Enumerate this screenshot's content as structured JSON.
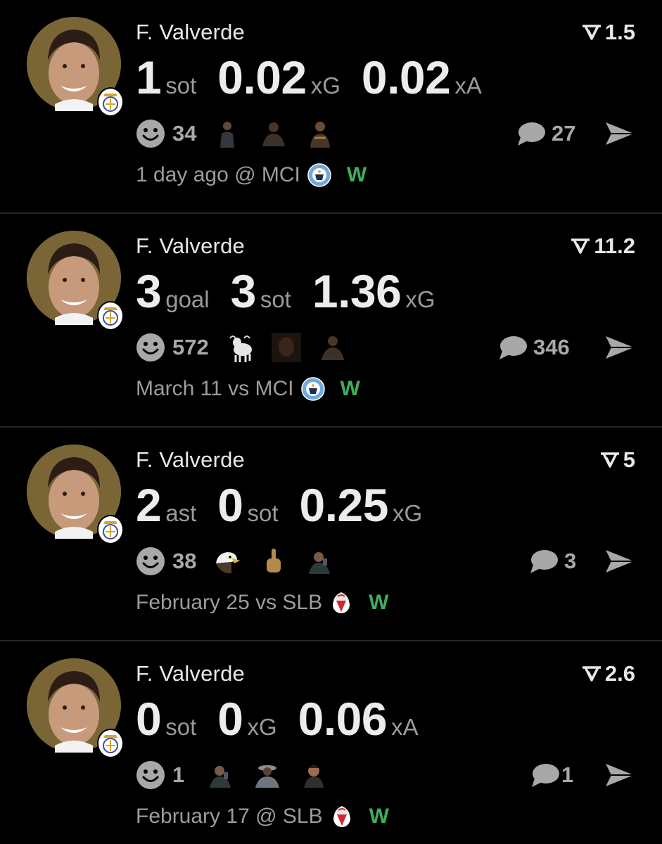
{
  "colors": {
    "background": "#000000",
    "primary_text": "#e8e8e8",
    "secondary_text": "#9c9c9c",
    "win": "#3fae5a",
    "avatar_ring": "#7a6536"
  },
  "posts": [
    {
      "player": "F. Valverde",
      "rating": "1.5",
      "stats": [
        {
          "value": "1",
          "unit": "sot"
        },
        {
          "value": "0.02",
          "unit": "xG"
        },
        {
          "value": "0.02",
          "unit": "xA"
        }
      ],
      "reaction_count": "34",
      "reaction_thumbs": [
        "person-thumb",
        "person-thumb",
        "person-thumb"
      ],
      "comment_count": "27",
      "match": "1 day ago @ MCI",
      "team_logo": "man-city-logo-icon",
      "result": "W"
    },
    {
      "player": "F. Valverde",
      "rating": "11.2",
      "stats": [
        {
          "value": "3",
          "unit": "goal"
        },
        {
          "value": "3",
          "unit": "sot"
        },
        {
          "value": "1.36",
          "unit": "xG"
        }
      ],
      "reaction_count": "572",
      "reaction_thumbs": [
        "goat-thumb",
        "person-thumb",
        "person-thumb"
      ],
      "comment_count": "346",
      "match": "March 11 vs MCI",
      "team_logo": "man-city-logo-icon",
      "result": "W"
    },
    {
      "player": "F. Valverde",
      "rating": "5",
      "stats": [
        {
          "value": "2",
          "unit": "ast"
        },
        {
          "value": "0",
          "unit": "sot"
        },
        {
          "value": "0.25",
          "unit": "xG"
        }
      ],
      "reaction_count": "38",
      "reaction_thumbs": [
        "eagle-thumb",
        "hand-thumb",
        "person-thumb"
      ],
      "comment_count": "3",
      "match": "February 25 vs SLB",
      "team_logo": "benfica-logo-icon",
      "result": "W"
    },
    {
      "player": "F. Valverde",
      "rating": "2.6",
      "stats": [
        {
          "value": "0",
          "unit": "sot"
        },
        {
          "value": "0",
          "unit": "xG"
        },
        {
          "value": "0.06",
          "unit": "xA"
        }
      ],
      "reaction_count": "1",
      "reaction_thumbs": [
        "person-thumb",
        "person-thumb",
        "person-thumb"
      ],
      "comment_count": "1",
      "match": "February 17 @ SLB",
      "team_logo": "benfica-logo-icon",
      "result": "W"
    }
  ]
}
